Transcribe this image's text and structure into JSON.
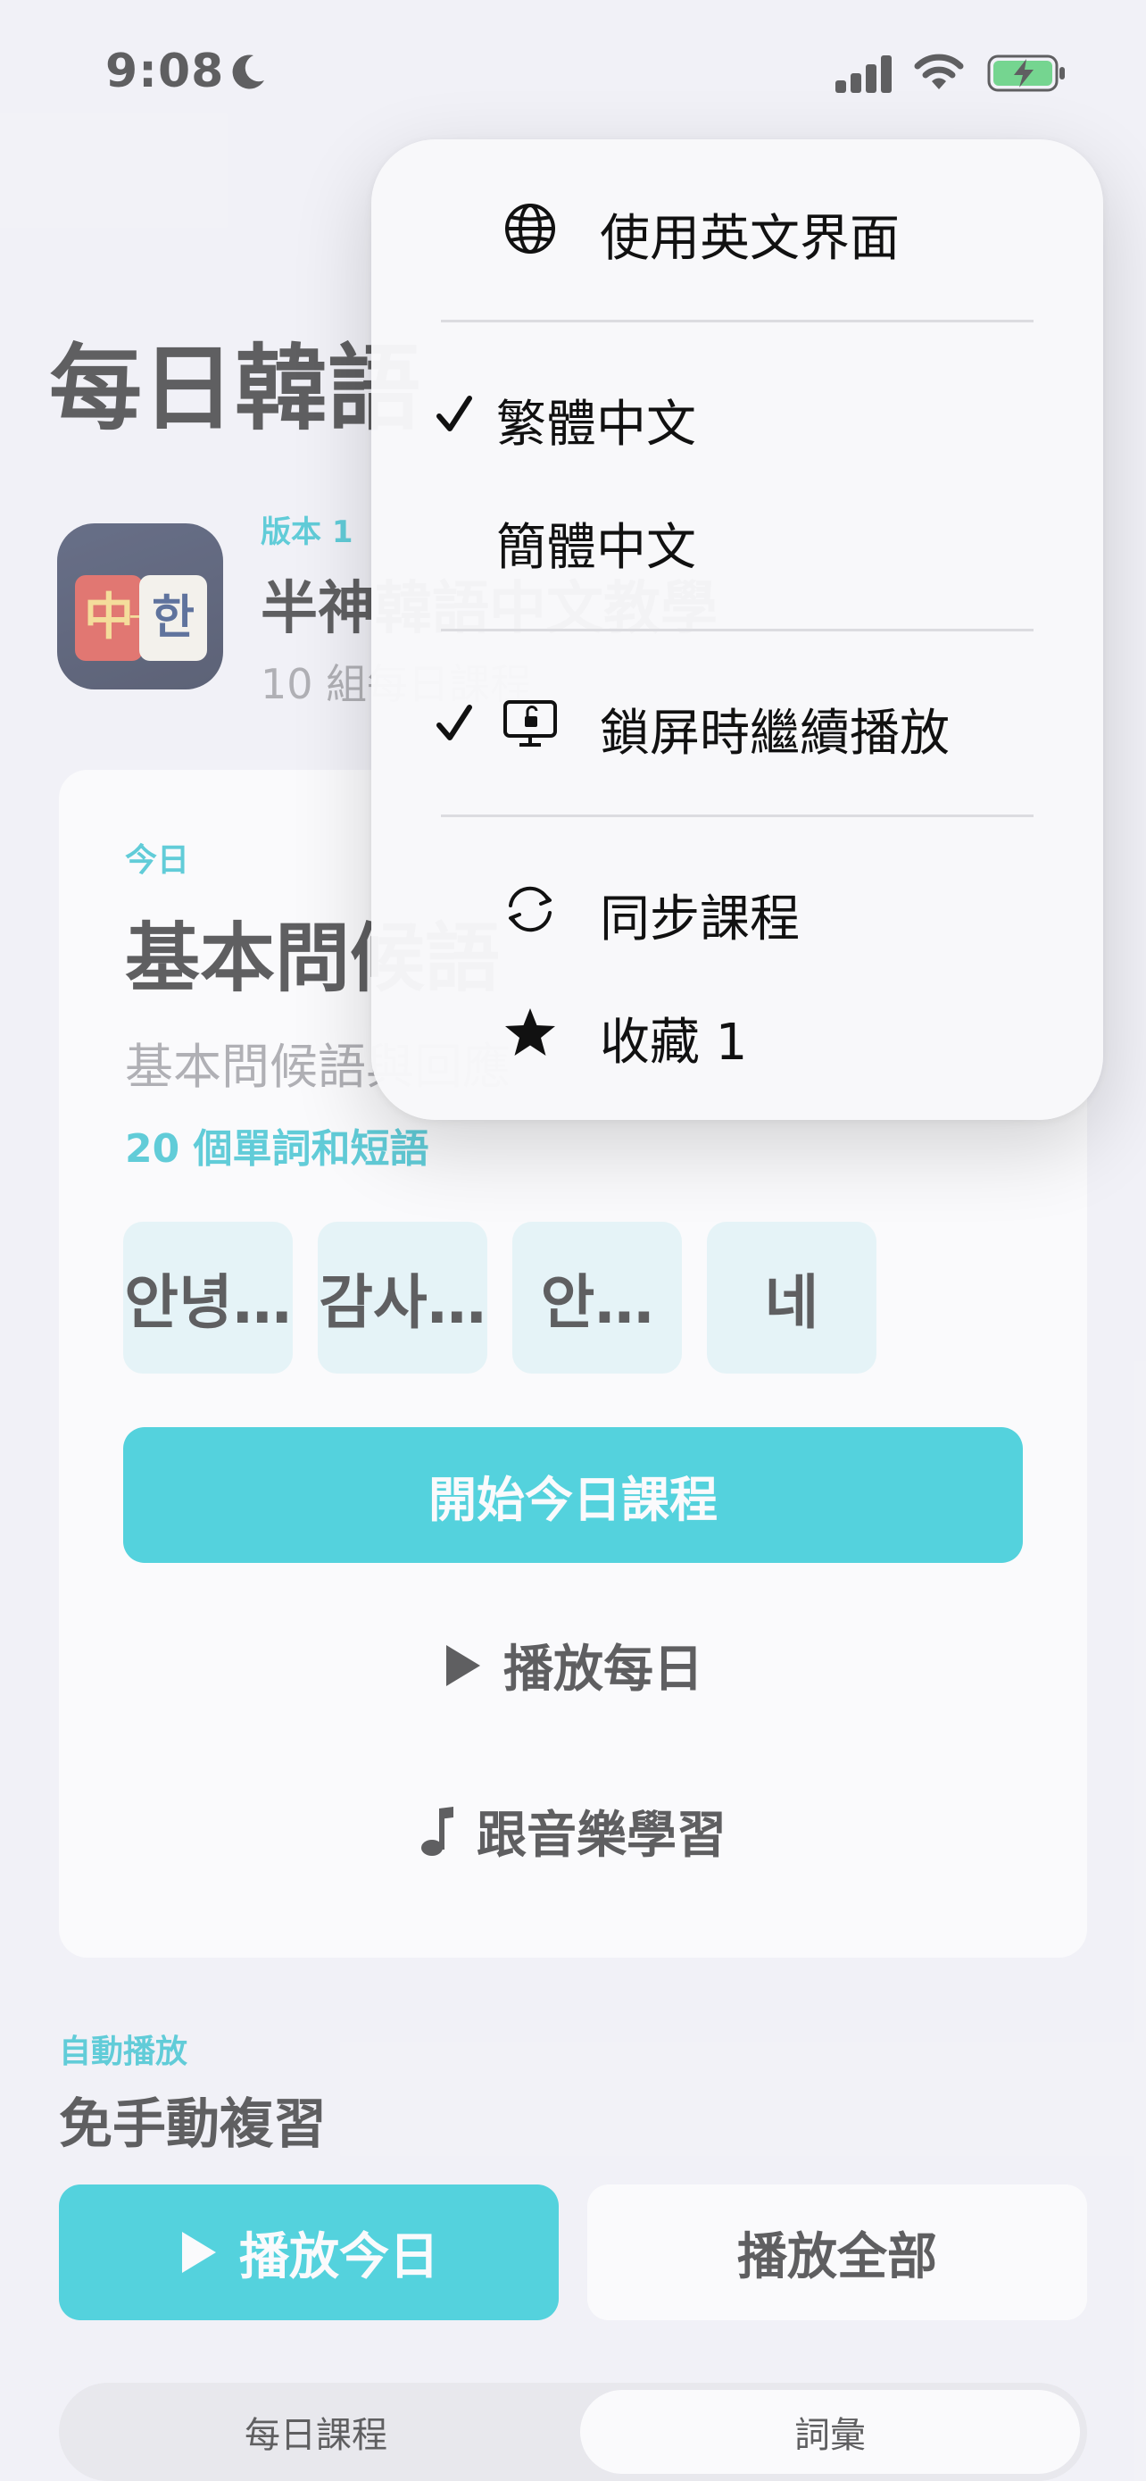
{
  "status_bar": {
    "time": "9:08"
  },
  "header": {
    "title": "每日韓語"
  },
  "course": {
    "version": "版本 1",
    "name": "半神韓語中文教學",
    "subtitle": "10 組每日課程"
  },
  "today_card": {
    "label": "今日",
    "title": "基本問候語",
    "subtitle": "基本問候語與回應",
    "word_count": "20 個單詞和短語",
    "chips": [
      "안녕…",
      "감사…",
      "안…",
      "네"
    ],
    "start_button": "開始今日課程",
    "play_daily": "播放每日",
    "music_learn": "跟音樂學習"
  },
  "autoplay": {
    "label": "自動播放",
    "title": "免手動複習",
    "play_today": "播放今日",
    "play_all": "播放全部"
  },
  "tabs": {
    "left": "每日課程",
    "right": "詞彙",
    "selected": "詞彙"
  },
  "menu": {
    "english_ui": "使用英文界面",
    "traditional": "繁體中文",
    "simplified": "簡體中文",
    "lock_screen": "鎖屏時繼續播放",
    "sync": "同步課程",
    "favorites": "收藏 1"
  },
  "colors": {
    "accent": "#00c2cf",
    "accent_text": "#14b8c8",
    "battery": "#34c759"
  },
  "icons": [
    "moon-icon",
    "cellular-signal-icon",
    "wifi-icon",
    "battery-charging-icon",
    "globe-icon",
    "checkmark-icon",
    "lock-screen-icon",
    "sync-icon",
    "star-icon",
    "play-icon",
    "music-note-icon"
  ]
}
